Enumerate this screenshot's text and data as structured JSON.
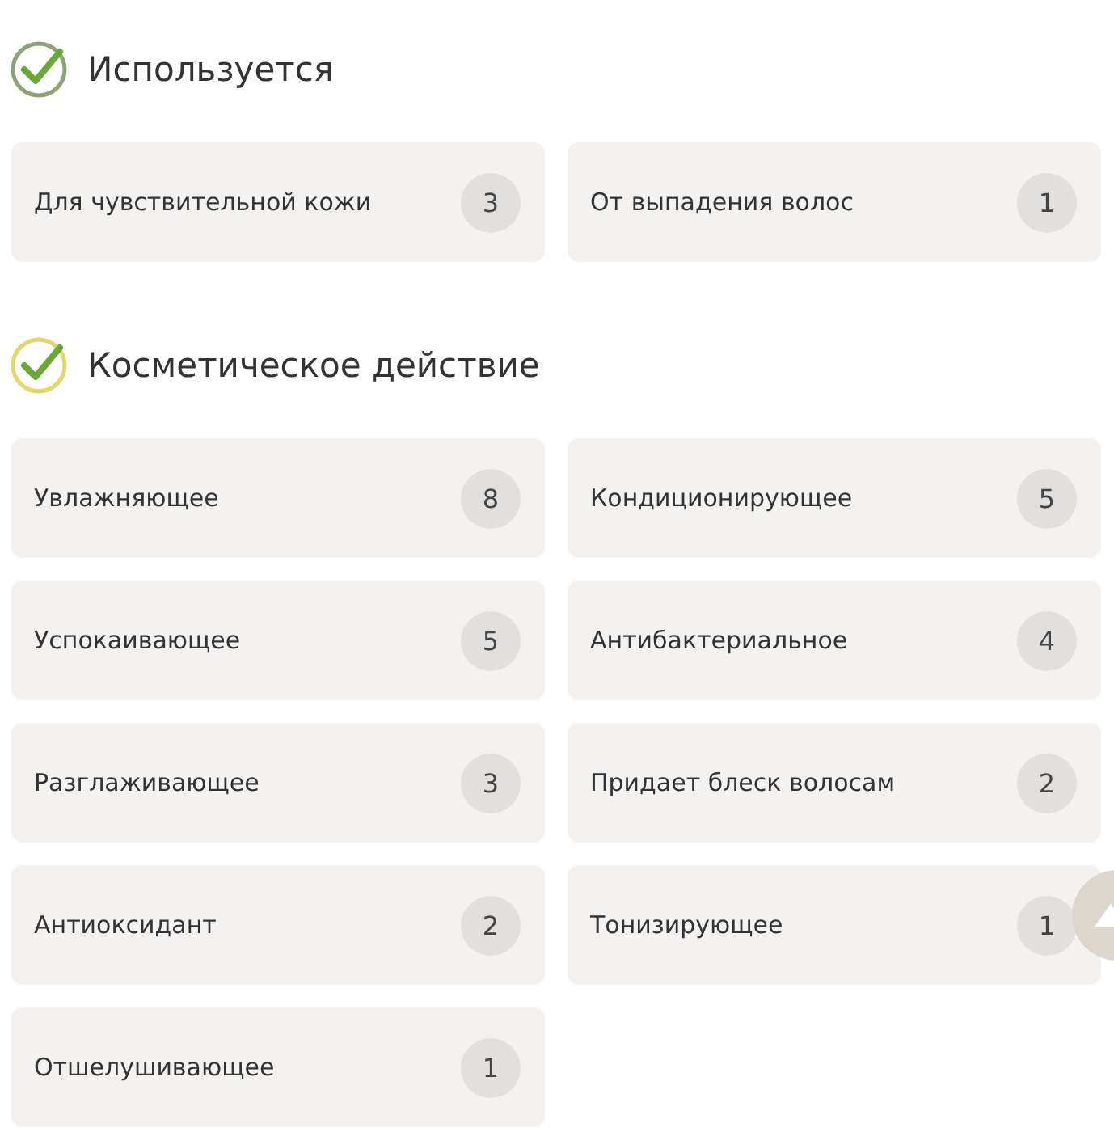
{
  "sections": [
    {
      "title": "Используется",
      "color": "#8fa37a",
      "items": [
        {
          "label": "Для чувствительной кожи",
          "count": "3"
        },
        {
          "label": "От выпадения волос",
          "count": "1"
        }
      ]
    },
    {
      "title": "Косметическое действие",
      "color": "#e3d66a",
      "items": [
        {
          "label": "Увлажняющее",
          "count": "8"
        },
        {
          "label": "Кондиционирующее",
          "count": "5"
        },
        {
          "label": "Успокаивающее",
          "count": "5"
        },
        {
          "label": "Антибактериальное",
          "count": "4"
        },
        {
          "label": "Разглаживающее",
          "count": "3"
        },
        {
          "label": "Придает блеск волосам",
          "count": "2"
        },
        {
          "label": "Антиоксидант",
          "count": "2"
        },
        {
          "label": "Тонизирующее",
          "count": "1"
        },
        {
          "label": "Отшелушивающее",
          "count": "1"
        }
      ]
    }
  ]
}
